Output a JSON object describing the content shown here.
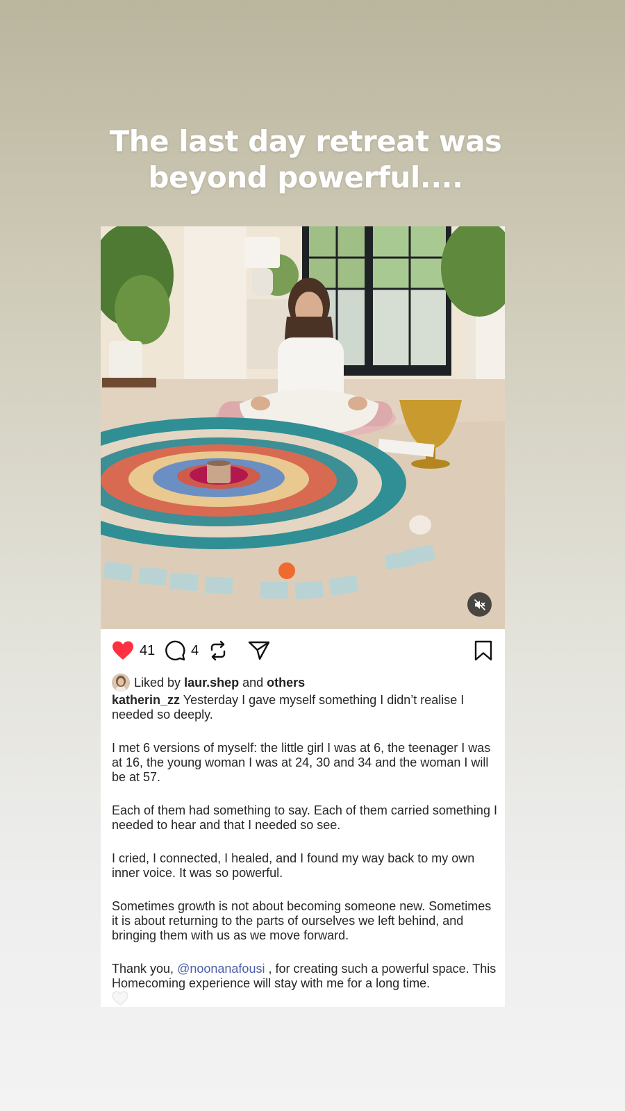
{
  "story": {
    "line1": "The last day retreat was",
    "line2": "beyond powerful...."
  },
  "post": {
    "likes": "41",
    "comments": "4",
    "liked_by_prefix": "Liked by",
    "liked_by_user": "laur.shep",
    "liked_by_and": "and",
    "liked_by_others": "others",
    "author": "katherin_zz",
    "para1": "Yesterday I gave myself something I didn’t realise I needed so deeply.",
    "para2": "I met 6 versions of myself: the little girl I was at 6, the teenager I was at 16, the young woman I was at 24, 30 and 34 and the woman I will be at 57.",
    "para3": "Each of them had something to say. Each of them carried something I needed to hear and that I needed so see.",
    "para4": "I cried, I connected, I healed, and I found my way back to my own inner voice. It was so powerful.",
    "para5": "Sometimes growth is not about becoming someone new. Sometimes it is about returning to the parts of ourselves we left behind, and bringing them with us as we move forward.",
    "para6_start": "Thank you,",
    "para6_mention": "@noonanafousi",
    "para6_end": ", for creating such a powerful space. This Homecoming experience will stay with me for a long time."
  },
  "icons": {
    "like": "heart-icon",
    "comment": "comment-icon",
    "repost": "repost-icon",
    "share": "send-icon",
    "save": "bookmark-icon",
    "mute": "speaker-muted-icon"
  },
  "colors": {
    "like_red": "#ff3040",
    "mention_blue": "#4b5ea8"
  }
}
